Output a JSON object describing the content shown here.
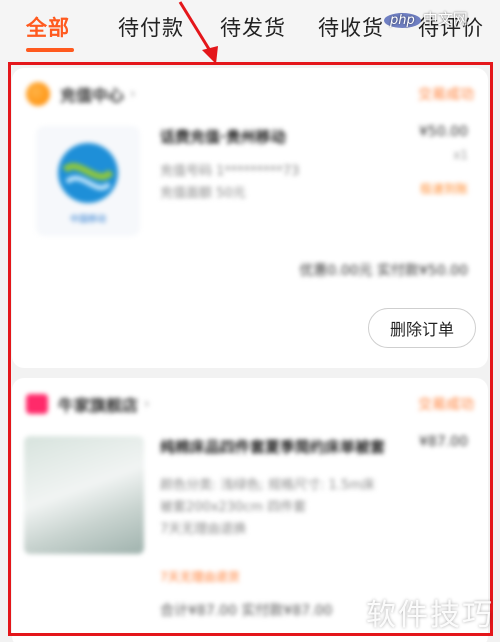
{
  "tabs": [
    {
      "label": "全部",
      "active": true
    },
    {
      "label": "待付款",
      "active": false
    },
    {
      "label": "待发货",
      "active": false
    },
    {
      "label": "待收货",
      "active": false
    },
    {
      "label": "待评价",
      "active": false
    }
  ],
  "watermark_top": {
    "badge": "php",
    "text": "中文网"
  },
  "watermark_bottom": "软件技巧",
  "orders": [
    {
      "store_name": "充值中心",
      "status": "交易成功",
      "title": "话费充值·贵州移动",
      "subs": [
        "充值号码 1*********73",
        "充值面额 50元"
      ],
      "price": "¥50.00",
      "qty": "x1",
      "tag": "极速到账",
      "summary": "优惠0.00元  实付款¥50.00",
      "delete_label": "删除订单"
    },
    {
      "store_name": "牛家旗舰店",
      "status": "交易成功",
      "title": "纯棉床品四件套夏季简约床单被套",
      "subs": [
        "颜色分类: 浅绿色; 规格尺寸: 1.5m床",
        "被套200x230cm 四件套",
        "7天无理由退换"
      ],
      "price": "¥87.00",
      "tag": "7天无理由退货",
      "summary": "合计¥87.00  实付款¥87.00"
    }
  ]
}
